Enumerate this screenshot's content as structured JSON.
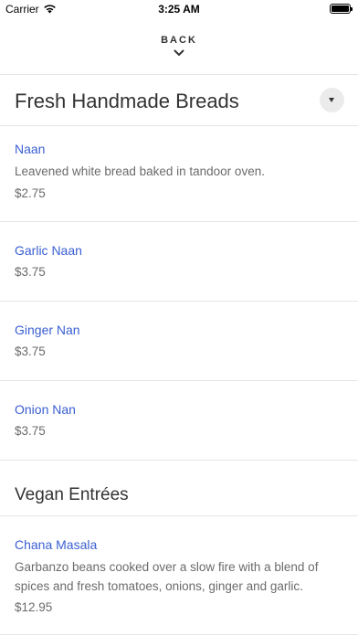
{
  "status_bar": {
    "carrier": "Carrier",
    "time": "3:25 AM"
  },
  "nav": {
    "back_label": "BACK"
  },
  "sections": [
    {
      "title": "Fresh Handmade Breads",
      "items": [
        {
          "name": "Naan",
          "description": "Leavened white bread baked in tandoor oven.",
          "price": "$2.75"
        },
        {
          "name": "Garlic Naan",
          "price": "$3.75"
        },
        {
          "name": "Ginger Nan",
          "price": "$3.75"
        },
        {
          "name": "Onion Nan",
          "price": "$3.75"
        }
      ]
    },
    {
      "title": "Vegan Entrées",
      "items": [
        {
          "name": "Chana Masala",
          "description": "Garbanzo beans cooked over a slow fire with a blend of spices and fresh tomatoes, onions, ginger and garlic.",
          "price": "$12.95"
        }
      ]
    }
  ]
}
